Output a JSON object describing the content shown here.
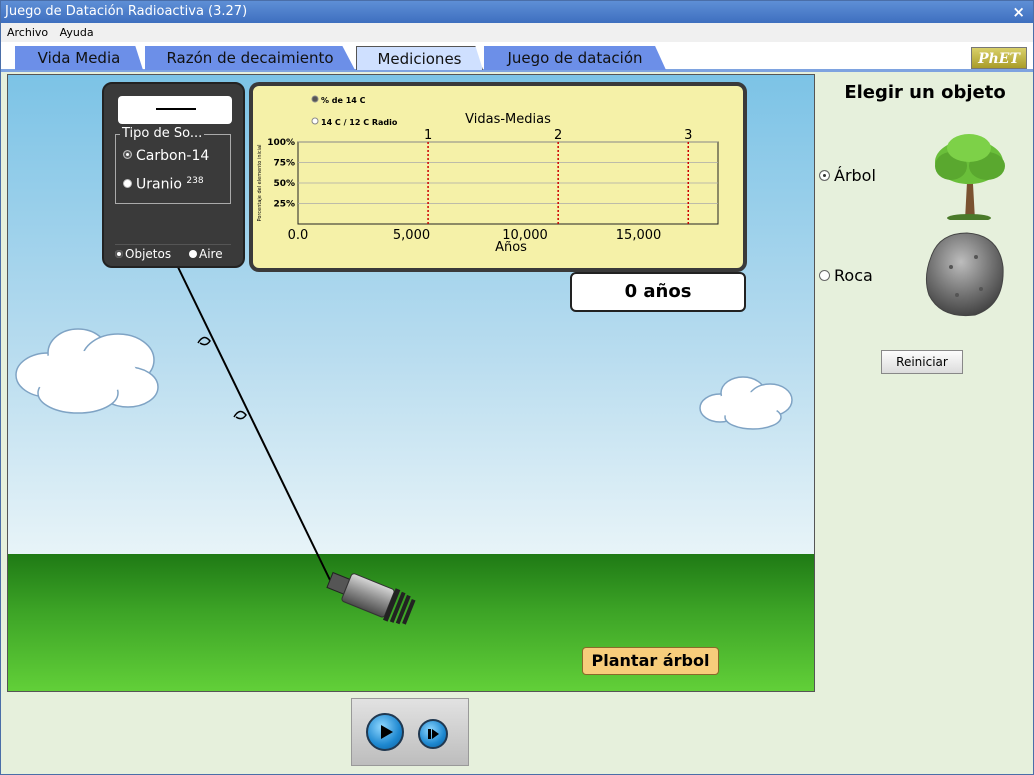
{
  "window": {
    "title": "Juego de Datación Radioactiva (3.27)",
    "close_glyph": "×"
  },
  "menu": {
    "items": [
      "Archivo",
      "Ayuda"
    ]
  },
  "tabs": [
    {
      "label": "Vida Media",
      "active": false
    },
    {
      "label": "Razón de decaimiento",
      "active": false
    },
    {
      "label": "Mediciones",
      "active": true
    },
    {
      "label": "Juego de datación",
      "active": false
    }
  ],
  "logo": "PhET",
  "meter": {
    "display_value": "",
    "source_type_legend": "Tipo de So...",
    "sources": [
      {
        "label": "Carbon-14",
        "selected": true
      },
      {
        "label": "Uranio",
        "superscript": "238",
        "selected": false
      }
    ],
    "targets": [
      {
        "label": "Objetos",
        "selected": true
      },
      {
        "label": "Aire",
        "selected": false
      }
    ]
  },
  "chart_data": {
    "type": "line",
    "title": "Vidas-Medias",
    "xlabel": "Años",
    "ylabel": "Porcentaje del elemento inicial",
    "mode_options": [
      {
        "label": "% de 14 C",
        "selected": true
      },
      {
        "label": "14 C / 12 C Radio",
        "selected": false
      }
    ],
    "x_ticks": [
      "0.0",
      "5,000",
      "10,000",
      "15,000"
    ],
    "y_ticks": [
      "100%",
      "75%",
      "50%",
      "25%"
    ],
    "xlim": [
      0,
      18500
    ],
    "ylim": [
      0,
      100
    ],
    "half_life_markers": [
      {
        "label": "1",
        "x": 5730
      },
      {
        "label": "2",
        "x": 11460
      },
      {
        "label": "3",
        "x": 17190
      }
    ],
    "series": [],
    "grid": true
  },
  "elapsed_time": "0 años",
  "plant_button": "Plantar árbol",
  "side_panel": {
    "title": "Elegir un objeto",
    "objects": [
      {
        "label": "Árbol",
        "icon": "tree-icon",
        "selected": true
      },
      {
        "label": "Roca",
        "icon": "rock-icon",
        "selected": false
      }
    ],
    "reset_button": "Reiniciar"
  },
  "clock_controls": {
    "play": "play-icon",
    "step": "step-icon"
  },
  "colors": {
    "sky_top": "#7cc3e6",
    "ground": "#3ca326",
    "chart_bg": "#f5f1a8",
    "marker": "#cc0000",
    "tab": "#6c8fe8"
  }
}
